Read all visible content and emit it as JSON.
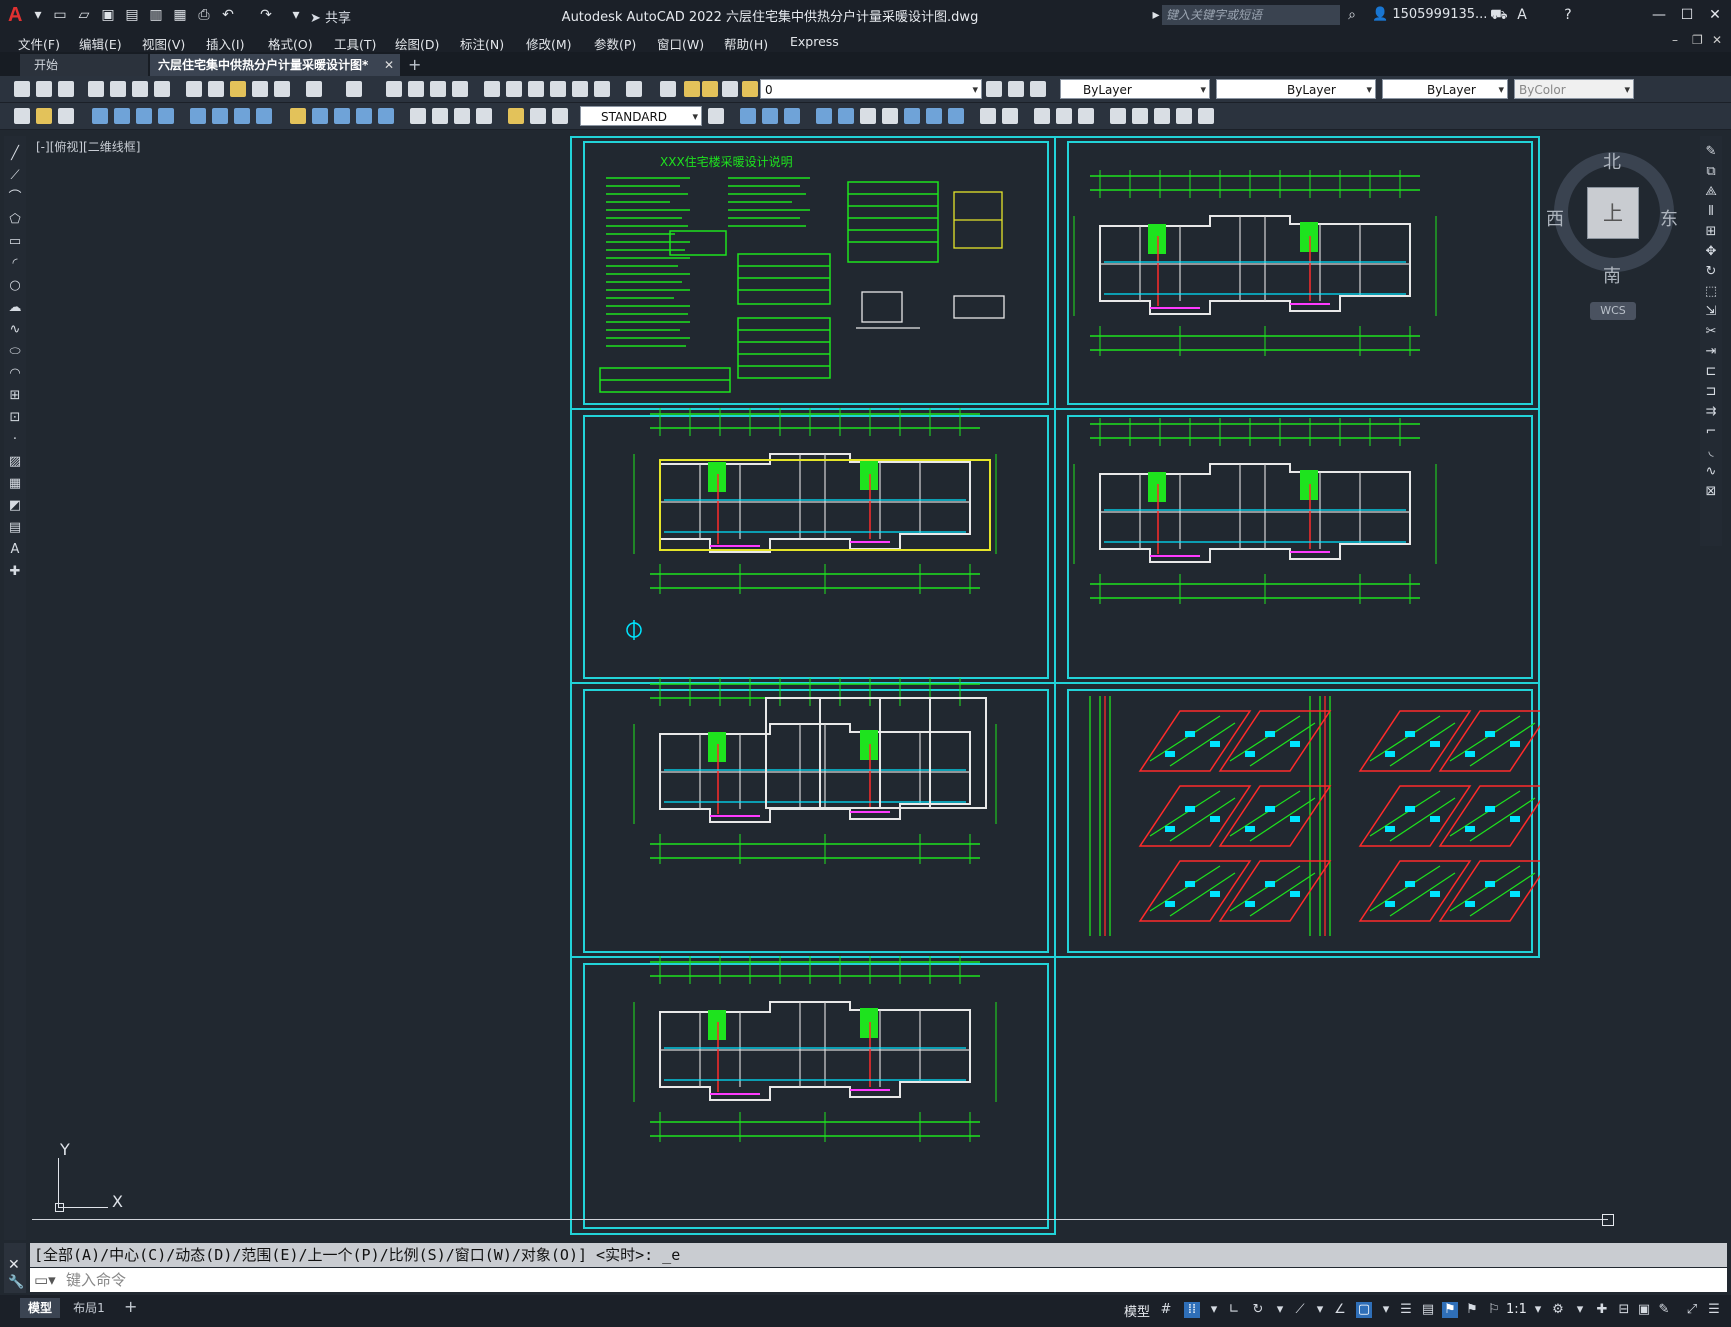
{
  "title_bar": {
    "share_label": "共享",
    "app_title": "Autodesk AutoCAD 2022    六层住宅集中供热分户计量采暖设计图.dwg",
    "search_placeholder": "键入关键字或短语",
    "user_label": "1505999135..."
  },
  "menu": [
    "文件(F)",
    "编辑(E)",
    "视图(V)",
    "插入(I)",
    "格式(O)",
    "工具(T)",
    "绘图(D)",
    "标注(N)",
    "修改(M)",
    "参数(P)",
    "窗口(W)",
    "帮助(H)",
    "Express"
  ],
  "tabs": {
    "start": "开始",
    "document": "六层住宅集中供热分户计量采暖设计图*",
    "add": "+"
  },
  "toolbar": {
    "layer_value": "0",
    "color_value": "ByLayer",
    "linetype_value": "ByLayer",
    "lineweight_value": "ByLayer",
    "plotstyle_value": "ByColor",
    "textstyle_value": "STANDARD"
  },
  "viewport": {
    "label": "[-][俯视][二维线框]"
  },
  "drawing": {
    "sheet1_title": "XXX住宅楼采暖设计说明"
  },
  "viewcube": {
    "north": "北",
    "south": "南",
    "east": "东",
    "west": "西",
    "face": "上",
    "wcs": "WCS"
  },
  "ucs": {
    "y": "Y",
    "x": "X"
  },
  "command": {
    "history": "[全部(A)/中心(C)/动态(D)/范围(E)/上一个(P)/比例(S)/窗口(W)/对象(O)] <实时>: _e",
    "placeholder": "键入命令"
  },
  "status": {
    "model_tab": "模型",
    "layout_tab": "布局1",
    "model_label": "模型",
    "scale": "1:1"
  },
  "colors": {
    "frame": "#22d3d8",
    "plan_green": "#1ee31e",
    "background": "#212830"
  }
}
